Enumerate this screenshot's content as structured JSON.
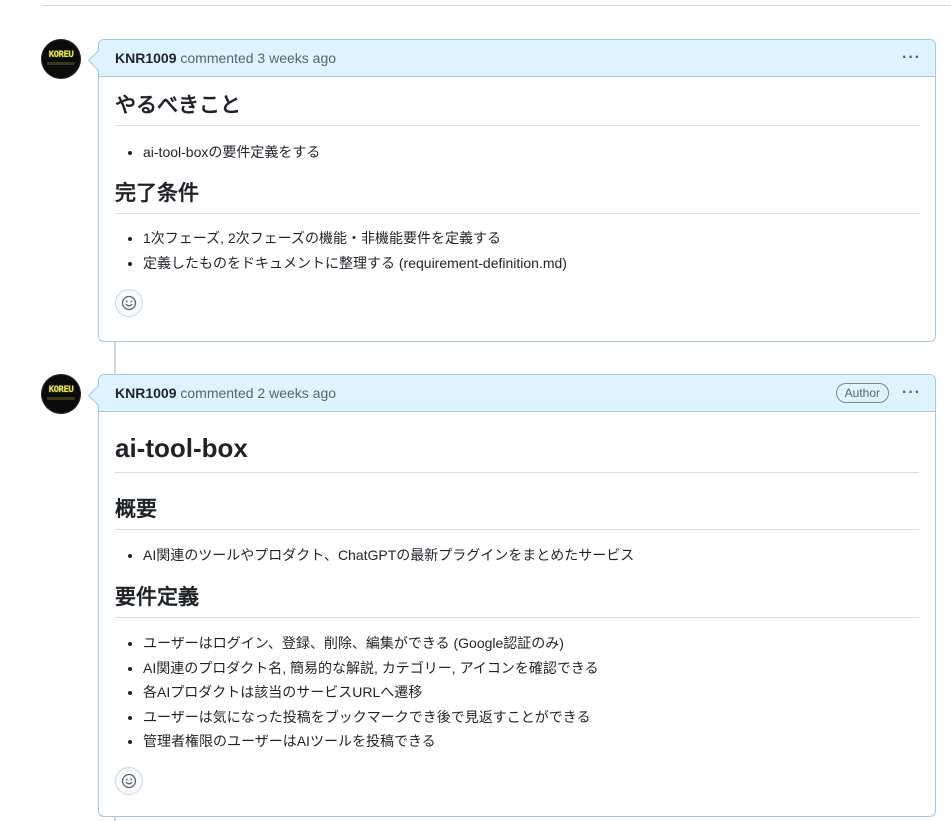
{
  "comments": [
    {
      "author": "KNR1009",
      "meta": "commented 3 weeks ago",
      "badge": "",
      "menu_label": "···",
      "sections": [
        {
          "heading": "やるべきこと",
          "items": [
            "ai-tool-boxの要件定義をする"
          ]
        },
        {
          "heading": "完了条件",
          "items": [
            "1次フェーズ, 2次フェーズの機能・非機能要件を定義する",
            "定義したものをドキュメントに整理する (requirement-definition.md)"
          ]
        }
      ]
    },
    {
      "author": "KNR1009",
      "meta": "commented 2 weeks ago",
      "badge": "Author",
      "menu_label": "···",
      "title": "ai-tool-box",
      "sections": [
        {
          "heading": "概要",
          "items": [
            "AI関連のツールやプロダクト、ChatGPTの最新プラグインをまとめたサービス"
          ]
        },
        {
          "heading": "要件定義",
          "items": [
            "ユーザーはログイン、登録、削除、編集ができる (Google認証のみ)",
            "AI関連のプロダクト名, 簡易的な解説, カテゴリー, アイコンを確認できる",
            "各AIプロダクトは該当のサービスURLへ遷移",
            "ユーザーは気になった投稿をブックマークでき後で見返すことができる",
            "管理者権限のユーザーはAIツールを投稿できる"
          ]
        }
      ]
    }
  ],
  "avatar_logo_text": "KOREU",
  "icons": {
    "menu": "kebab-horizontal-icon",
    "reaction": "smiley-icon"
  },
  "colors": {
    "header_bg": "#ddf4ff",
    "header_border": "#a8c7e6",
    "text": "#1f2328",
    "muted": "#59636e"
  }
}
